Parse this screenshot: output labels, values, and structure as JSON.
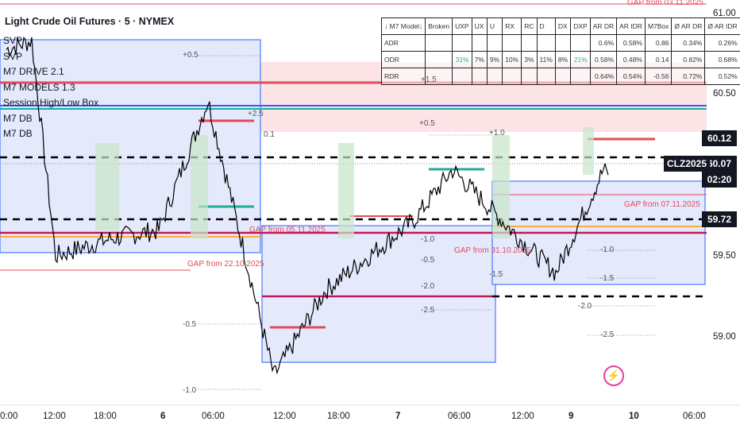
{
  "header": {
    "title": "Light Crude Oil Futures · 5 · NYMEX"
  },
  "legend": [
    {
      "label": "SVP"
    },
    {
      "label": "SVP"
    },
    {
      "label": "M7 DRIVE 2.1"
    },
    {
      "label": "M7 MODELS 1.3"
    },
    {
      "label": "Session High/Low Box"
    },
    {
      "label": "M7 DB"
    },
    {
      "label": "M7 DB"
    }
  ],
  "stats_table": {
    "headers": [
      "↓ M7 Model↓",
      "Broken",
      "UXP",
      "UX",
      "U",
      "RX",
      "RC",
      "D",
      "DX",
      "DXP",
      "AR DR",
      "AR IDR",
      "M7Box",
      "Ø AR DR",
      "Ø AR IDR"
    ],
    "rows": [
      {
        "label": "ADR",
        "cells": [
          "",
          "",
          "",
          "",
          "",
          "",
          "",
          "",
          "",
          "",
          "0.6%",
          "0.58%",
          "0.86",
          "0.34%",
          "0.26%"
        ]
      },
      {
        "label": "ODR",
        "cells": [
          "",
          "",
          "31%",
          "7%",
          "9%",
          "10%",
          "3%",
          "11%",
          "8%",
          "21%",
          "0.58%",
          "0.48%",
          "0.14",
          "0.82%",
          "0.68%"
        ]
      },
      {
        "label": "RDR",
        "cells": [
          "",
          "",
          "",
          "",
          "",
          "",
          "",
          "",
          "",
          "",
          "0.64%",
          "0.54%",
          "-0.56",
          "0.72%",
          "0.52%"
        ]
      }
    ]
  },
  "price_axis": {
    "labels": [
      {
        "text": "61.00"
      },
      {
        "text": "60.50"
      },
      {
        "text": "59.50"
      },
      {
        "text": "59.00"
      }
    ],
    "tags": [
      {
        "text": "60.12",
        "color": "#131722"
      },
      {
        "text": "60.07",
        "color": "#131722"
      },
      {
        "text": "02:20",
        "color": "#131722"
      },
      {
        "text": "59.72",
        "color": "#131722"
      }
    ],
    "symbol_tag": "CLZ2025"
  },
  "time_axis": {
    "labels": [
      {
        "text": "0:00"
      },
      {
        "text": "12:00"
      },
      {
        "text": "18:00"
      },
      {
        "text": "6"
      },
      {
        "text": "06:00"
      },
      {
        "text": "12:00"
      },
      {
        "text": "18:00"
      },
      {
        "text": "7"
      },
      {
        "text": "06:00"
      },
      {
        "text": "12:00"
      },
      {
        "text": "9"
      },
      {
        "text": "10"
      },
      {
        "text": "06:00"
      }
    ]
  },
  "gap_labels": [
    {
      "text": "GAP from 03.11.2025",
      "color": "#e24b5b"
    },
    {
      "text": "GAP from 07.11.2025",
      "color": "#e24b5b"
    },
    {
      "text": "GAP from 05.11.2025",
      "color": "#e24b5b"
    },
    {
      "text": "GAP from 22.10.2025",
      "color": "#e24b5b"
    },
    {
      "text": "GAP from 31.10.2025",
      "color": "#e24b5b"
    }
  ],
  "level_labels": [
    {
      "text": "+0.5"
    },
    {
      "text": "+2.5"
    },
    {
      "text": "+1.5"
    },
    {
      "text": "+1.0"
    },
    {
      "text": "+0.5"
    },
    {
      "text": "0.1"
    },
    {
      "text": "-0.5"
    },
    {
      "text": "-1.0"
    },
    {
      "text": "-1.5"
    },
    {
      "text": "-2.0"
    },
    {
      "text": "-2.5"
    },
    {
      "text": "-1.0"
    },
    {
      "text": "-1.5"
    },
    {
      "text": "-2.0"
    },
    {
      "text": "-2.5"
    },
    {
      "text": "-1.0"
    },
    {
      "text": "-0.5"
    }
  ],
  "colors": {
    "up": "#22ab94",
    "down": "#e24b5b",
    "box": "#2962ff",
    "line": "#000000"
  },
  "chart_data": {
    "type": "line",
    "title": "Light Crude Oil Futures · 5 · NYMEX",
    "ylim": [
      58.75,
      61.05
    ],
    "x": [
      "5 00:00",
      "5 06:00",
      "5 12:00",
      "5 18:00",
      "6 00:00",
      "6 06:00",
      "6 12:00",
      "6 18:00",
      "7 00:00",
      "7 06:00",
      "7 12:00",
      "7 18:00",
      "9 18:00",
      "10 00:00",
      "10 02:20"
    ],
    "series": [
      {
        "values": [
          60.8,
          60.85,
          59.6,
          59.7,
          59.75,
          60.5,
          58.9,
          59.4,
          59.8,
          60.1,
          59.65,
          59.5,
          59.95,
          60.1,
          60.07
        ]
      }
    ]
  }
}
